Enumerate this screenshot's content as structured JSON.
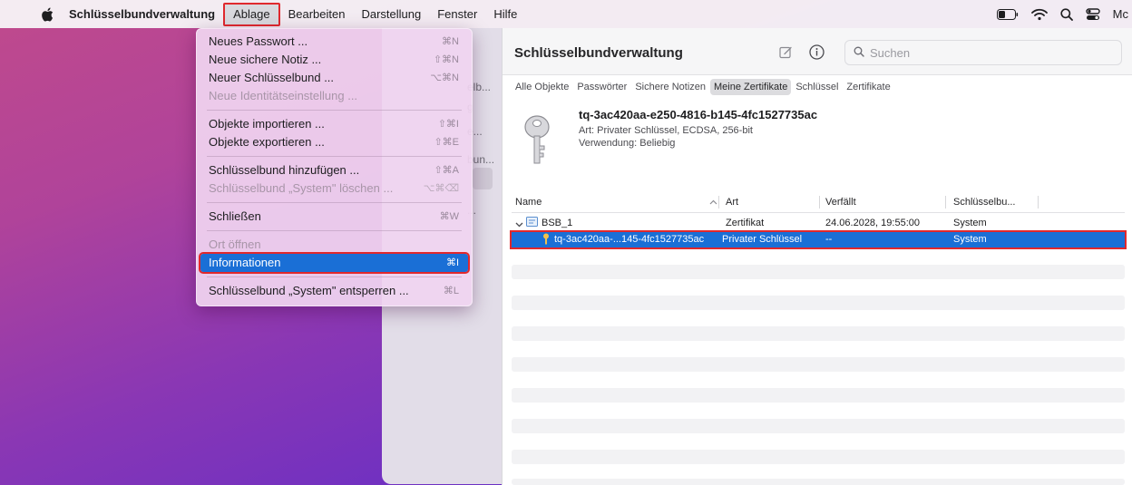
{
  "menubar": {
    "app": "Schlüsselbundverwaltung",
    "items": [
      "Ablage",
      "Bearbeiten",
      "Darstellung",
      "Fenster",
      "Hilfe"
    ],
    "right_text": "Mc"
  },
  "menu": {
    "items": [
      {
        "label": "Neues Passwort ...",
        "shortcut": "⌘N",
        "disabled": false
      },
      {
        "label": "Neue sichere Notiz ...",
        "shortcut": "⇧⌘N",
        "disabled": false
      },
      {
        "label": "Neuer Schlüsselbund ...",
        "shortcut": "⌥⌘N",
        "disabled": false
      },
      {
        "label": "Neue Identitätseinstellung ...",
        "shortcut": "",
        "disabled": true
      },
      {
        "label": "Objekte importieren ...",
        "shortcut": "⇧⌘I",
        "disabled": false
      },
      {
        "label": "Objekte exportieren ...",
        "shortcut": "⇧⌘E",
        "disabled": false
      },
      {
        "label": "Schlüsselbund hinzufügen ...",
        "shortcut": "⇧⌘A",
        "disabled": false
      },
      {
        "label": "Schlüsselbund „System\" löschen ...",
        "shortcut": "⌥⌘⌫",
        "disabled": true
      },
      {
        "label": "Schließen",
        "shortcut": "⌘W",
        "disabled": false
      },
      {
        "label": "Ort öffnen",
        "shortcut": "",
        "disabled": true
      },
      {
        "label": "Informationen",
        "shortcut": "⌘I",
        "disabled": false
      },
      {
        "label": "Schlüsselbund „System\" entsperren ...",
        "shortcut": "⌘L",
        "disabled": false
      }
    ]
  },
  "sidebar_fragments": [
    "elb...",
    "g",
    "e...",
    "bun...",
    "..."
  ],
  "window": {
    "title": "Schlüsselbundverwaltung",
    "search_placeholder": "Suchen",
    "tabs": [
      "Alle Objekte",
      "Passwörter",
      "Sichere Notizen",
      "Meine Zertifikate",
      "Schlüssel",
      "Zertifikate"
    ],
    "selected_tab": "Meine Zertifikate",
    "detail": {
      "name": "tq-3ac420aa-e250-4816-b145-4fc1527735ac",
      "art": "Art: Privater Schlüssel, ECDSA, 256-bit",
      "verwendung": "Verwendung: Beliebig"
    },
    "columns": [
      "Name",
      "Art",
      "Verfällt",
      "Schlüsselbu..."
    ],
    "rows": [
      {
        "name": "BSB_1",
        "art": "Zertifikat",
        "verfaellt": "24.06.2028, 19:55:00",
        "keychain": "System"
      },
      {
        "name": "tq-3ac420aa-...145-4fc1527735ac",
        "art": "Privater Schlüssel",
        "verfaellt": "--",
        "keychain": "System"
      }
    ]
  },
  "colors": {
    "accent": "#1a6fd6",
    "highlight_border": "#e0282d"
  }
}
